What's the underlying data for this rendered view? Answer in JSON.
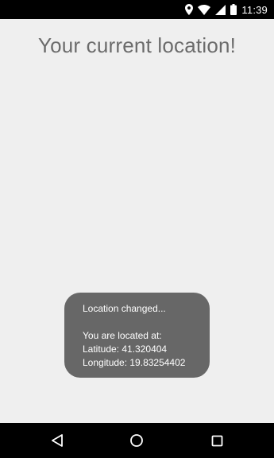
{
  "status_bar": {
    "time": "11:39",
    "icons": [
      "location-icon",
      "wifi-icon",
      "signal-icon",
      "battery-icon"
    ]
  },
  "main": {
    "title": "Your current location!"
  },
  "toast": {
    "line1": "Location changed...",
    "line2": "You are located at:",
    "line3": "Latitude: 41.320404",
    "line4": "Longitude: 19.83254402"
  },
  "nav_bar": {
    "icons": [
      "back-icon",
      "home-icon",
      "recents-icon"
    ]
  },
  "colors": {
    "background": "#efefef",
    "title_text": "#6b6b6b",
    "toast_bg": "#676767",
    "bars": "#000000"
  }
}
